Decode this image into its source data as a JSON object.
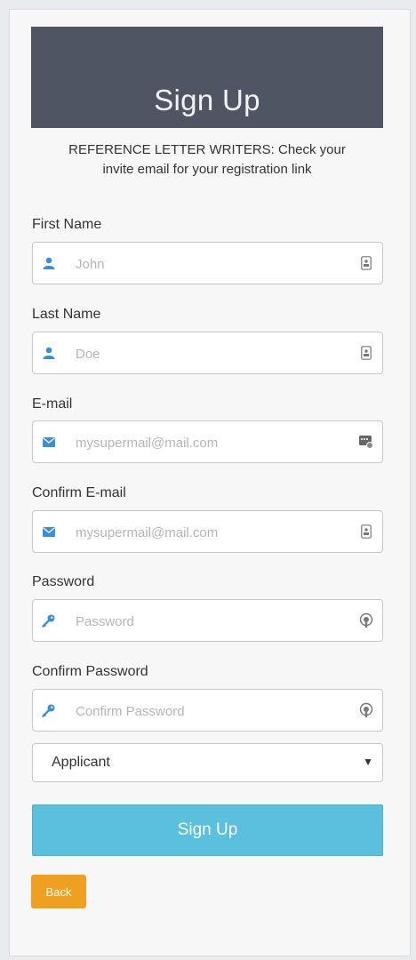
{
  "header": {
    "title": "Sign Up"
  },
  "notice": {
    "line1": "REFERENCE LETTER WRITERS: Check your",
    "line2": "invite email for your registration link"
  },
  "fields": {
    "first_name": {
      "label": "First Name",
      "placeholder": "John",
      "value": "",
      "lead_icon": "user-icon",
      "trail_icon": "contact-card-icon"
    },
    "last_name": {
      "label": "Last Name",
      "placeholder": "Doe",
      "value": "",
      "lead_icon": "user-icon",
      "trail_icon": "contact-card-icon"
    },
    "email": {
      "label": "E-mail",
      "placeholder": "mysupermail@mail.com",
      "value": "",
      "lead_icon": "envelope-icon",
      "trail_icon": "password-manager-icon"
    },
    "confirm_email": {
      "label": "Confirm E-mail",
      "placeholder": "mysupermail@mail.com",
      "value": "",
      "lead_icon": "envelope-icon",
      "trail_icon": "contact-card-icon"
    },
    "password": {
      "label": "Password",
      "placeholder": "Password",
      "value": "",
      "lead_icon": "key-icon",
      "trail_icon": "password-manager-icon"
    },
    "confirm_password": {
      "label": "Confirm Password",
      "placeholder": "Confirm Password",
      "value": "",
      "lead_icon": "key-icon",
      "trail_icon": "password-manager-icon"
    }
  },
  "role_select": {
    "selected": "Applicant",
    "caret": "▼"
  },
  "buttons": {
    "signup": "Sign Up",
    "back": "Back"
  },
  "colors": {
    "header_bg": "#4f5563",
    "icon_blue": "#3a8fd8",
    "signup_bg": "#5bc0de",
    "back_bg": "#f0a020"
  }
}
